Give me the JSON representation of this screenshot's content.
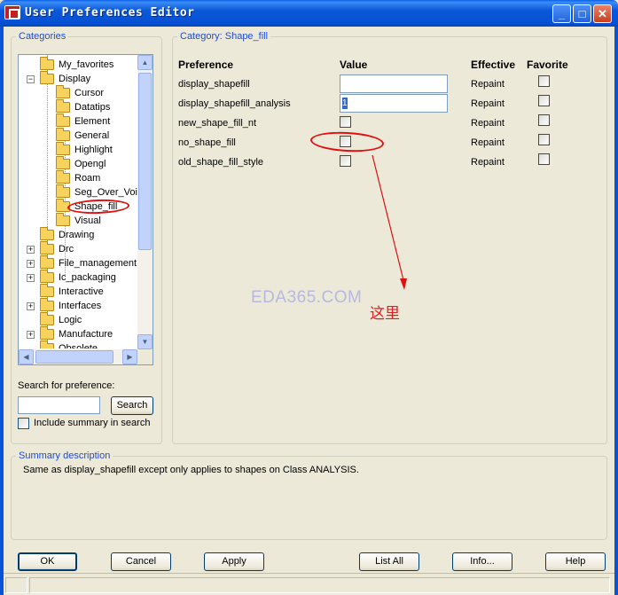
{
  "window": {
    "title": "User Preferences Editor",
    "controls": {
      "minimize": "_",
      "maximize": "□",
      "close": "✕"
    }
  },
  "categories": {
    "legend": "Categories",
    "tree": [
      {
        "label": "My_favorites",
        "level": 1,
        "expander": "",
        "selected": false
      },
      {
        "label": "Display",
        "level": 1,
        "expander": "−",
        "selected": false
      },
      {
        "label": "Cursor",
        "level": 2,
        "expander": "",
        "selected": false
      },
      {
        "label": "Datatips",
        "level": 2,
        "expander": "",
        "selected": false
      },
      {
        "label": "Element",
        "level": 2,
        "expander": "",
        "selected": false
      },
      {
        "label": "General",
        "level": 2,
        "expander": "",
        "selected": false
      },
      {
        "label": "Highlight",
        "level": 2,
        "expander": "",
        "selected": false
      },
      {
        "label": "Opengl",
        "level": 2,
        "expander": "",
        "selected": false
      },
      {
        "label": "Roam",
        "level": 2,
        "expander": "",
        "selected": false
      },
      {
        "label": "Seg_Over_Voi",
        "level": 2,
        "expander": "",
        "selected": false
      },
      {
        "label": "Shape_fill",
        "level": 2,
        "expander": "",
        "selected": true
      },
      {
        "label": "Visual",
        "level": 2,
        "expander": "",
        "selected": false
      },
      {
        "label": "Drawing",
        "level": 1,
        "expander": "",
        "selected": false
      },
      {
        "label": "Drc",
        "level": 1,
        "expander": "+",
        "selected": false
      },
      {
        "label": "File_management",
        "level": 1,
        "expander": "+",
        "selected": false
      },
      {
        "label": "Ic_packaging",
        "level": 1,
        "expander": "+",
        "selected": false
      },
      {
        "label": "Interactive",
        "level": 1,
        "expander": "",
        "selected": false
      },
      {
        "label": "Interfaces",
        "level": 1,
        "expander": "+",
        "selected": false
      },
      {
        "label": "Logic",
        "level": 1,
        "expander": "",
        "selected": false
      },
      {
        "label": "Manufacture",
        "level": 1,
        "expander": "+",
        "selected": false
      },
      {
        "label": "Obsolete",
        "level": 1,
        "expander": "",
        "selected": false
      }
    ]
  },
  "search": {
    "label": "Search for preference:",
    "value": "",
    "button": "Search",
    "include_summary_label": "Include summary in search",
    "include_summary_checked": false
  },
  "category_panel": {
    "legend": "Category:  Shape_fill",
    "columns": {
      "preference": "Preference",
      "value": "Value",
      "effective": "Effective",
      "favorite": "Favorite"
    },
    "rows": [
      {
        "name": "display_shapefill",
        "value_type": "text",
        "value": "",
        "effective": "Repaint",
        "favorite": false
      },
      {
        "name": "display_shapefill_analysis",
        "value_type": "text",
        "value": "1",
        "effective": "Repaint",
        "favorite": false
      },
      {
        "name": "new_shape_fill_nt",
        "value_type": "checkbox",
        "value": false,
        "effective": "Repaint",
        "favorite": false
      },
      {
        "name": "no_shape_fill",
        "value_type": "checkbox",
        "value": false,
        "effective": "Repaint",
        "favorite": false
      },
      {
        "name": "old_shape_fill_style",
        "value_type": "checkbox",
        "value": false,
        "effective": "Repaint",
        "favorite": false
      }
    ]
  },
  "annotations": {
    "watermark": "EDA365.COM",
    "note": "这里",
    "color": "#e01010"
  },
  "summary": {
    "legend": "Summary description",
    "text": "Same as display_shapefill except only applies to shapes on Class ANALYSIS."
  },
  "buttons": {
    "ok": "OK",
    "cancel": "Cancel",
    "apply": "Apply",
    "list_all": "List All",
    "info": "Info...",
    "help": "Help"
  },
  "colors": {
    "titlebar": "#0a58d8",
    "accent_text": "#1c4bd8",
    "window_bg": "#ece9d8"
  }
}
